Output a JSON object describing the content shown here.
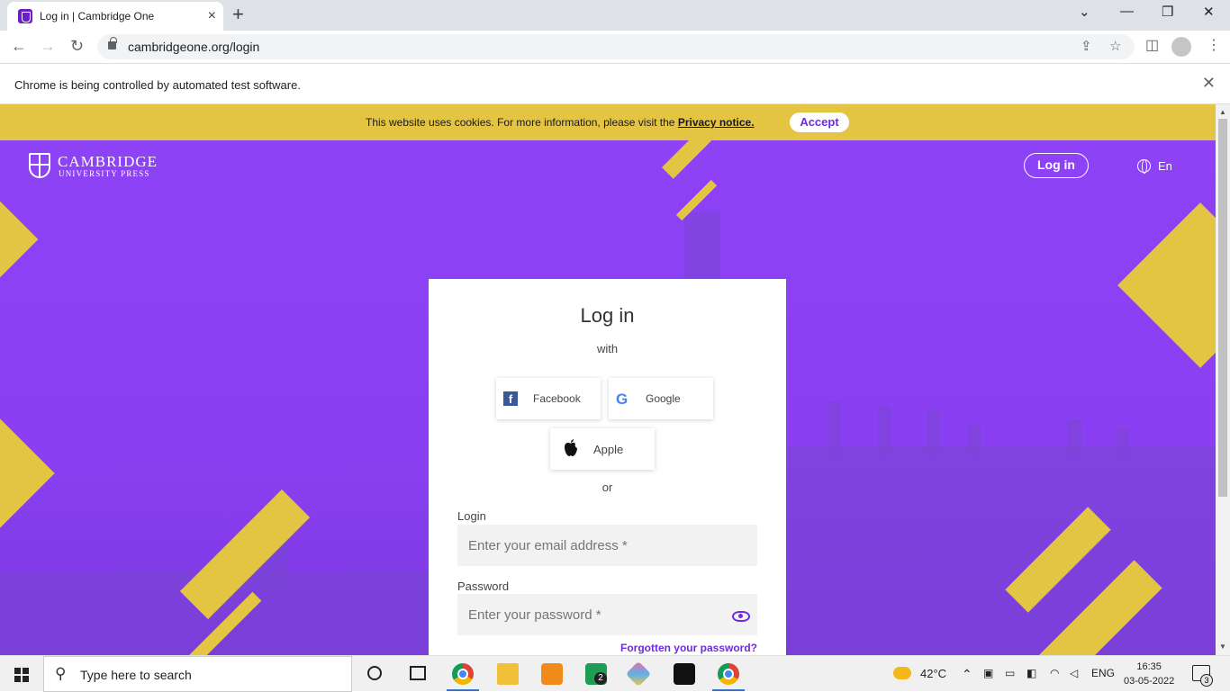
{
  "browser": {
    "tab_title": "Log in | Cambridge One",
    "url": "cambridgeone.org/login",
    "infobar": "Chrome is being controlled by automated test software."
  },
  "cookie": {
    "text": "This website uses cookies. For more information, please visit the ",
    "link": "Privacy notice.",
    "accept": "Accept"
  },
  "header": {
    "logo_main": "CAMBRIDGE",
    "logo_sub": "UNIVERSITY PRESS",
    "login_button": "Log in",
    "language": "En"
  },
  "card": {
    "title": "Log in",
    "with": "with",
    "facebook": "Facebook",
    "google": "Google",
    "apple": "Apple",
    "or": "or",
    "login_label": "Login",
    "email_placeholder": "Enter your email address *",
    "password_label": "Password",
    "password_placeholder": "Enter your password *",
    "forgot": "Forgotten your password?"
  },
  "taskbar": {
    "search_placeholder": "Type here to search",
    "temperature": "42°C",
    "language": "ENG",
    "time": "16:35",
    "date": "03-05-2022",
    "notification_count": "3",
    "badge_count": "2"
  },
  "colors": {
    "brand_purple": "#8a3ff5",
    "accent_yellow": "#e4c443",
    "link_purple": "#6e2be2"
  },
  "icons": {
    "tab_close": "×",
    "new_tab": "+",
    "back": "←",
    "forward": "→",
    "reload": "↻",
    "minimize": "—",
    "maximize": "❐",
    "close": "✕",
    "share": "⇪",
    "star": "☆",
    "sidepanel": "◫",
    "menu": "⋮",
    "infobar_close": "✕",
    "search": "⚲"
  }
}
